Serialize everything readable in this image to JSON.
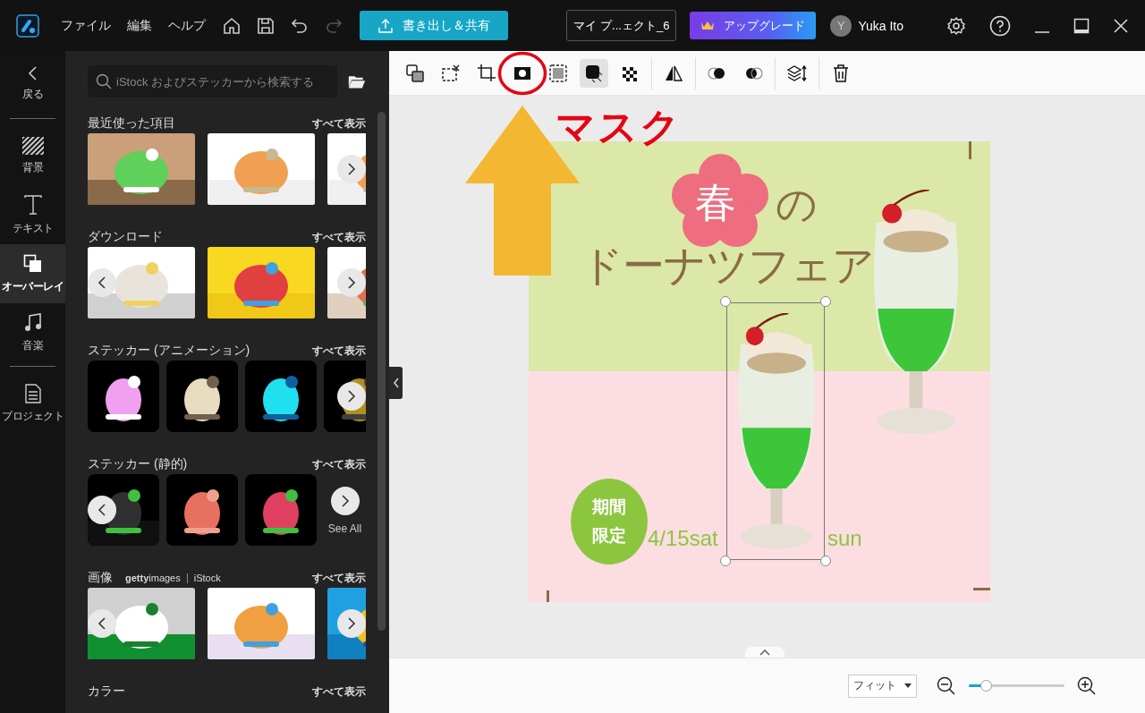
{
  "app_bar": {
    "menus": [
      "ファイル",
      "編集",
      "ヘルプ"
    ],
    "redo_disabled": true,
    "export_label": "書き出し＆共有",
    "project_name": "マイ プ...ェクト_6",
    "upgrade_label": "アップグレード",
    "user": {
      "initial": "Y",
      "name": "Yuka Ito"
    }
  },
  "nav": {
    "back_label": "戻る",
    "items": [
      {
        "kind": "background",
        "label": "背景",
        "selected": false
      },
      {
        "kind": "text",
        "label": "テキスト",
        "selected": false
      },
      {
        "kind": "overlay",
        "label": "オーバーレイ",
        "selected": true
      },
      {
        "kind": "music",
        "label": "音楽",
        "selected": false
      },
      {
        "kind": "project",
        "label": "プロジェクト",
        "selected": false
      }
    ]
  },
  "panel": {
    "search": {
      "placeholder": "iStock およびステッカーから検索する"
    },
    "sections": [
      {
        "title": "最近使った項目",
        "see_all": "すべて表示",
        "prev": false,
        "next": true,
        "items": [
          {
            "kind": "picture"
          },
          {
            "kind": "picture"
          },
          {
            "kind": "picture"
          }
        ]
      },
      {
        "title": "ダウンロード",
        "see_all": "すべて表示",
        "prev": true,
        "next": true,
        "items": [
          {
            "kind": "picture"
          },
          {
            "kind": "picture"
          },
          {
            "kind": "picture"
          }
        ]
      },
      {
        "title": "ステッカー (アニメーション)",
        "see_all": "すべて表示",
        "kind": "sticker",
        "prev": false,
        "next": true,
        "items": [
          {
            "kind": "picture"
          },
          {
            "kind": "picture"
          },
          {
            "kind": "picture"
          },
          {
            "kind": "picture"
          }
        ]
      },
      {
        "title": "ステッカー (静的)",
        "see_all": "すべて表示",
        "kind": "sticker",
        "prev": true,
        "next": false,
        "items": [
          {
            "kind": "picture"
          },
          {
            "kind": "picture"
          },
          {
            "kind": "picture"
          },
          {
            "kind": "see_all",
            "label": "See All"
          }
        ]
      },
      {
        "title": "画像",
        "providers": [
          "**getty**images",
          "iStock"
        ],
        "see_all": "すべて表示",
        "prev": true,
        "next": true,
        "items": [
          {
            "kind": "picture"
          },
          {
            "kind": "picture"
          },
          {
            "kind": "picture"
          }
        ]
      },
      {
        "title": "カラー",
        "see_all": "すべて表示",
        "kind": "color",
        "prev": false,
        "next": false
      }
    ]
  },
  "toolbar": {
    "groups": [
      [
        {
          "kind": "replace",
          "selected": false,
          "circled": false
        },
        {
          "kind": "cutout",
          "selected": false,
          "circled": false
        },
        {
          "kind": "crop",
          "selected": false,
          "circled": false
        },
        {
          "kind": "mask",
          "selected": false,
          "circled": true
        },
        {
          "kind": "border",
          "selected": false,
          "circled": false
        },
        {
          "kind": "shadow",
          "selected": true,
          "circled": false
        },
        {
          "kind": "opacity",
          "selected": false,
          "circled": false
        }
      ],
      [
        {
          "kind": "flip",
          "selected": false,
          "circled": false
        }
      ],
      [
        {
          "kind": "blend_back",
          "selected": false,
          "circled": false
        },
        {
          "kind": "blend_front",
          "selected": false,
          "circled": false
        }
      ],
      [
        {
          "kind": "arrange",
          "selected": false,
          "circled": false
        }
      ],
      [
        {
          "kind": "delete",
          "selected": false,
          "circled": false
        }
      ]
    ]
  },
  "annotation": {
    "label": "マスク"
  },
  "design": {
    "title_char": "春",
    "title_particle": "の",
    "title_line": "ドーナツフェア",
    "badge": [
      "期間",
      "限定"
    ],
    "date_start": "4/15sat",
    "date_end": "sun"
  },
  "bottom_bar": {
    "fit_label": "フィット",
    "zoom": {
      "level": 0.18
    }
  }
}
